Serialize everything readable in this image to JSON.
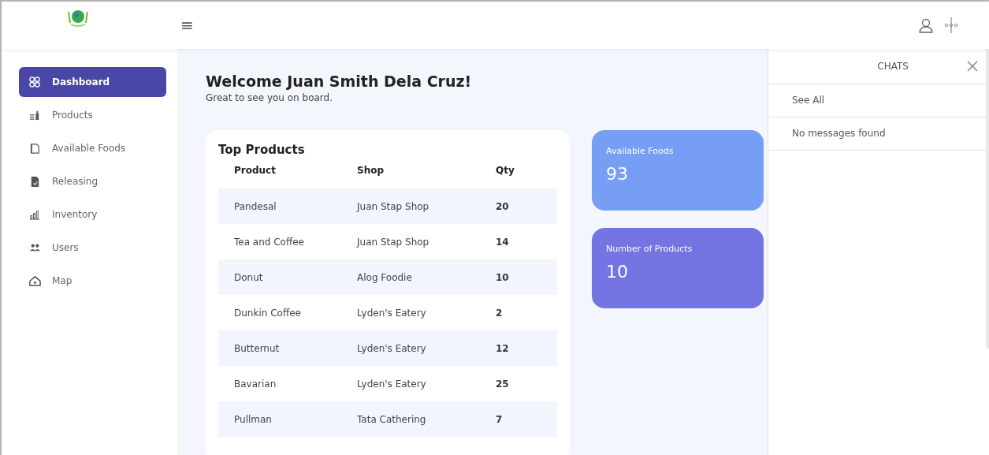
{
  "topbar": {
    "menu_icon": "≡"
  },
  "sidebar": {
    "items": [
      {
        "label": "Dashboard",
        "kind": "grid",
        "selected": true
      },
      {
        "label": "Products",
        "kind": "products",
        "selected": false
      },
      {
        "label": "Available Foods",
        "kind": "box",
        "selected": false
      },
      {
        "label": "Releasing",
        "kind": "file",
        "selected": false
      },
      {
        "label": "Inventory",
        "kind": "chart",
        "selected": false
      },
      {
        "label": "Users",
        "kind": "users",
        "selected": false
      },
      {
        "label": "Map",
        "kind": "home",
        "selected": false
      }
    ]
  },
  "welcome": {
    "title": "Welcome Juan Smith Dela Cruz!",
    "subtitle": "Great to see you on board."
  },
  "top_products": {
    "title": "Top Products",
    "columns": [
      "Product",
      "Shop",
      "Qty"
    ],
    "rows": [
      [
        "Pandesal",
        "Juan Stap Shop",
        "20"
      ],
      [
        "Tea and Coffee",
        "Juan Stap Shop",
        "14"
      ],
      [
        "Donut",
        "Alog Foodie",
        "10"
      ],
      [
        "Dunkin Coffee",
        "Lyden's Eatery",
        "2"
      ],
      [
        "Butternut",
        "Lyden's Eatery",
        "12"
      ],
      [
        "Bavarian",
        "Lyden's Eatery",
        "25"
      ],
      [
        "Pullman",
        "Tata Cathering",
        "7"
      ]
    ]
  },
  "stats": [
    {
      "label": "Available Foods",
      "value": "93",
      "color": "#769ef4"
    },
    {
      "label": "Number of Products",
      "value": "10",
      "color": "#7474e2"
    }
  ],
  "chats": {
    "title": "CHATS",
    "see_all": "See All",
    "empty": "No messages found"
  }
}
